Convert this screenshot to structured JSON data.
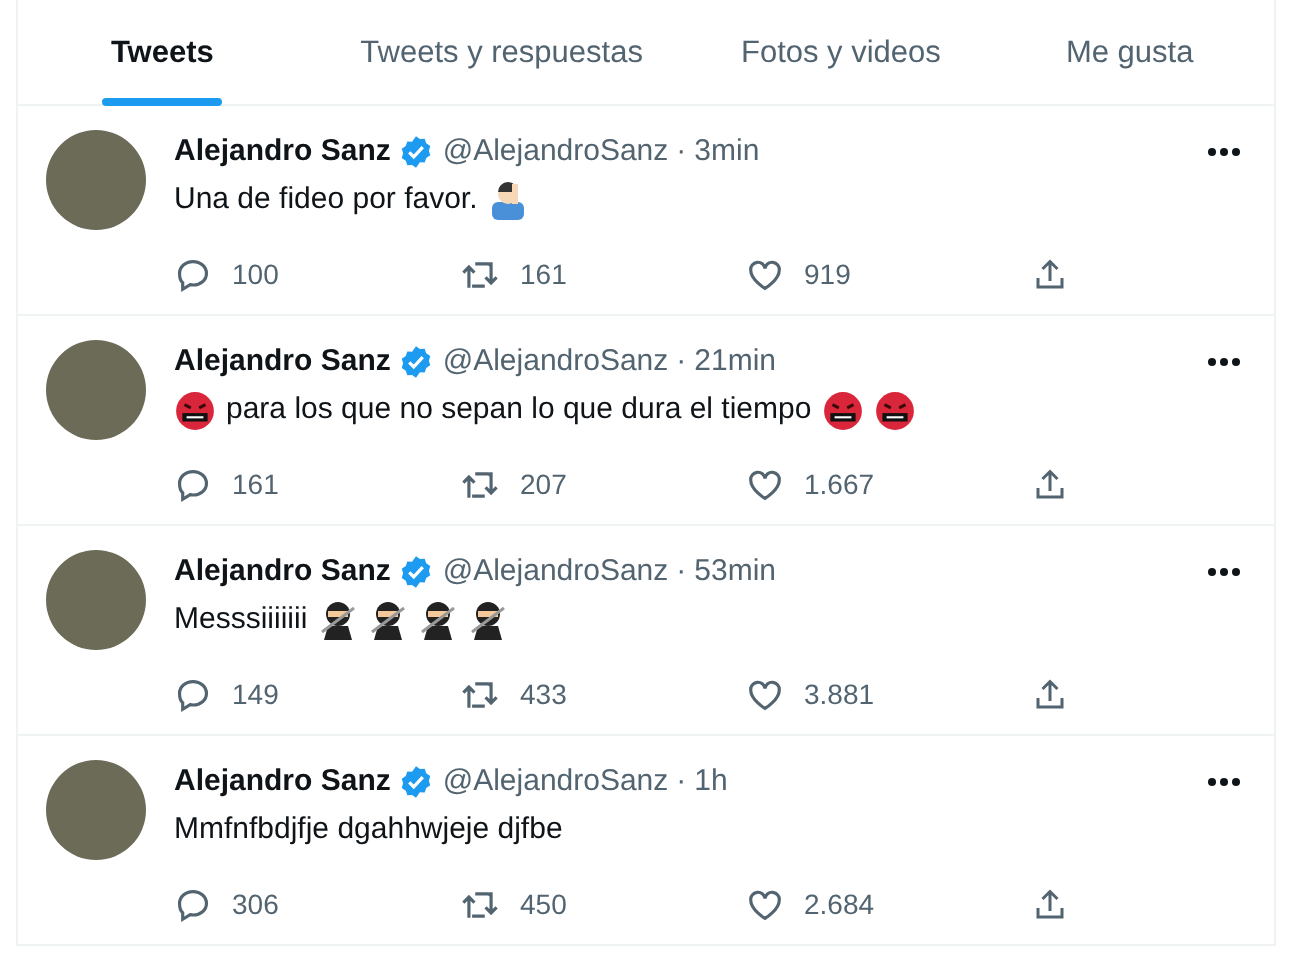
{
  "tabs": [
    {
      "label": "Tweets",
      "selected": true
    },
    {
      "label": "Tweets y respuestas",
      "selected": false
    },
    {
      "label": "Fotos y videos",
      "selected": false
    },
    {
      "label": "Me gusta",
      "selected": false
    }
  ],
  "tweets": [
    {
      "name": "Alejandro Sanz",
      "verified": true,
      "handle": "@AlejandroSanz",
      "separator": "·",
      "time": "3min",
      "parts": [
        {
          "kind": "text",
          "text": "Una de fideo por favor."
        },
        {
          "kind": "person"
        }
      ],
      "replies": "100",
      "retweets": "161",
      "likes": "919"
    },
    {
      "name": "Alejandro Sanz",
      "verified": true,
      "handle": "@AlejandroSanz",
      "separator": "·",
      "time": "21min",
      "parts": [
        {
          "kind": "censored"
        },
        {
          "kind": "text",
          "text": "para los que no sepan lo que dura el tiempo"
        },
        {
          "kind": "censored"
        },
        {
          "kind": "censored"
        }
      ],
      "replies": "161",
      "retweets": "207",
      "likes": "1.667"
    },
    {
      "name": "Alejandro Sanz",
      "verified": true,
      "handle": "@AlejandroSanz",
      "separator": "·",
      "time": "53min",
      "parts": [
        {
          "kind": "text",
          "text": "Messsiiiiiii"
        },
        {
          "kind": "ninja"
        },
        {
          "kind": "ninja"
        },
        {
          "kind": "ninja"
        },
        {
          "kind": "ninja"
        }
      ],
      "replies": "149",
      "retweets": "433",
      "likes": "3.881"
    },
    {
      "name": "Alejandro Sanz",
      "verified": true,
      "handle": "@AlejandroSanz",
      "separator": "·",
      "time": "1h",
      "parts": [
        {
          "kind": "text",
          "text": "Mmfnfbdjfje dgahhwjeje djfbe"
        }
      ],
      "replies": "306",
      "retweets": "450",
      "likes": "2.684"
    }
  ]
}
